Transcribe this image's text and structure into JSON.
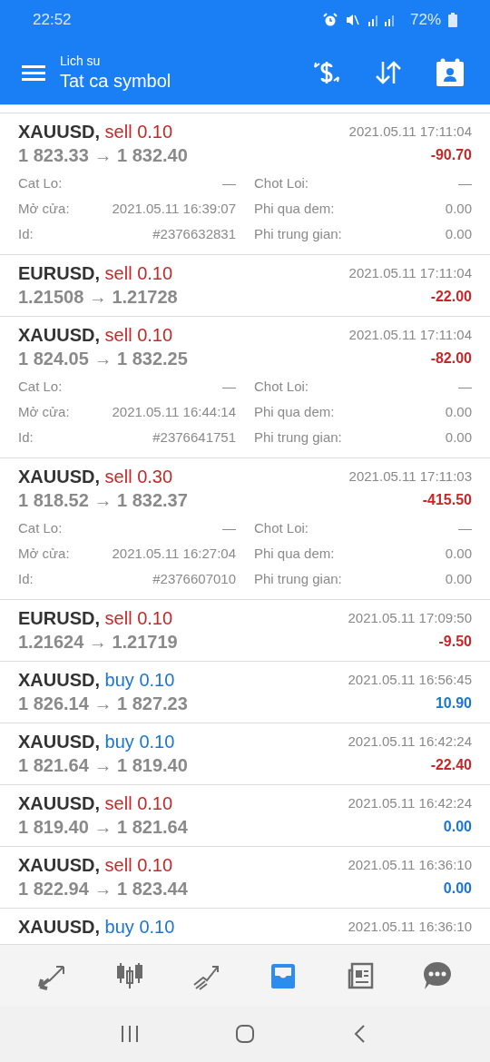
{
  "status_bar": {
    "time": "22:52",
    "battery": "72%"
  },
  "app_bar": {
    "subtitle": "Lich su",
    "title": "Tat ca symbol"
  },
  "trades": [
    {
      "symbol": "XAUUSD,",
      "side": "sell",
      "volume": "0.10",
      "time": "2021.05.11 17:11:04",
      "prices": "1 823.33 → 1 832.40",
      "profit": "-90.70",
      "loss": true,
      "details": [
        {
          "label": "Cat Lo:",
          "value": "—"
        },
        {
          "label": "Chot Loi:",
          "value": "—"
        },
        {
          "label": "Mở cửa:",
          "value": "2021.05.11 16:39:07"
        },
        {
          "label": "Phi qua dem:",
          "value": "0.00"
        },
        {
          "label": "Id:",
          "value": "#2376632831"
        },
        {
          "label": "Phi trung gian:",
          "value": "0.00"
        }
      ]
    },
    {
      "symbol": "EURUSD,",
      "side": "sell",
      "volume": "0.10",
      "time": "2021.05.11 17:11:04",
      "prices": "1.21508 → 1.21728",
      "profit": "-22.00",
      "loss": true
    },
    {
      "symbol": "XAUUSD,",
      "side": "sell",
      "volume": "0.10",
      "time": "2021.05.11 17:11:04",
      "prices": "1 824.05 → 1 832.25",
      "profit": "-82.00",
      "loss": true,
      "details": [
        {
          "label": "Cat Lo:",
          "value": "—"
        },
        {
          "label": "Chot Loi:",
          "value": "—"
        },
        {
          "label": "Mở cửa:",
          "value": "2021.05.11 16:44:14"
        },
        {
          "label": "Phi qua dem:",
          "value": "0.00"
        },
        {
          "label": "Id:",
          "value": "#2376641751"
        },
        {
          "label": "Phi trung gian:",
          "value": "0.00"
        }
      ]
    },
    {
      "symbol": "XAUUSD,",
      "side": "sell",
      "volume": "0.30",
      "time": "2021.05.11 17:11:03",
      "prices": "1 818.52 → 1 832.37",
      "profit": "-415.50",
      "loss": true,
      "details": [
        {
          "label": "Cat Lo:",
          "value": "—"
        },
        {
          "label": "Chot Loi:",
          "value": "—"
        },
        {
          "label": "Mở cửa:",
          "value": "2021.05.11 16:27:04"
        },
        {
          "label": "Phi qua dem:",
          "value": "0.00"
        },
        {
          "label": "Id:",
          "value": "#2376607010"
        },
        {
          "label": "Phi trung gian:",
          "value": "0.00"
        }
      ]
    },
    {
      "symbol": "EURUSD,",
      "side": "sell",
      "volume": "0.10",
      "time": "2021.05.11 17:09:50",
      "prices": "1.21624 → 1.21719",
      "profit": "-9.50",
      "loss": true
    },
    {
      "symbol": "XAUUSD,",
      "side": "buy",
      "volume": "0.10",
      "time": "2021.05.11 16:56:45",
      "prices": "1 826.14 → 1 827.23",
      "profit": "10.90",
      "loss": false
    },
    {
      "symbol": "XAUUSD,",
      "side": "buy",
      "volume": "0.10",
      "time": "2021.05.11 16:42:24",
      "prices": "1 821.64 → 1 819.40",
      "profit": "-22.40",
      "loss": true
    },
    {
      "symbol": "XAUUSD,",
      "side": "sell",
      "volume": "0.10",
      "time": "2021.05.11 16:42:24",
      "prices": "1 819.40 → 1 821.64",
      "profit": "0.00",
      "loss": false
    },
    {
      "symbol": "XAUUSD,",
      "side": "sell",
      "volume": "0.10",
      "time": "2021.05.11 16:36:10",
      "prices": "1 822.94 → 1 823.44",
      "profit": "0.00",
      "loss": false
    },
    {
      "symbol": "XAUUSD,",
      "side": "buy",
      "volume": "0.10",
      "time": "2021.05.11 16:36:10"
    }
  ],
  "bottom_nav": [
    {
      "kind": "quotes",
      "selected": false
    },
    {
      "kind": "chart",
      "selected": false
    },
    {
      "kind": "trade",
      "selected": false
    },
    {
      "kind": "history",
      "selected": true
    },
    {
      "kind": "news",
      "selected": false
    },
    {
      "kind": "chat",
      "selected": false
    }
  ]
}
